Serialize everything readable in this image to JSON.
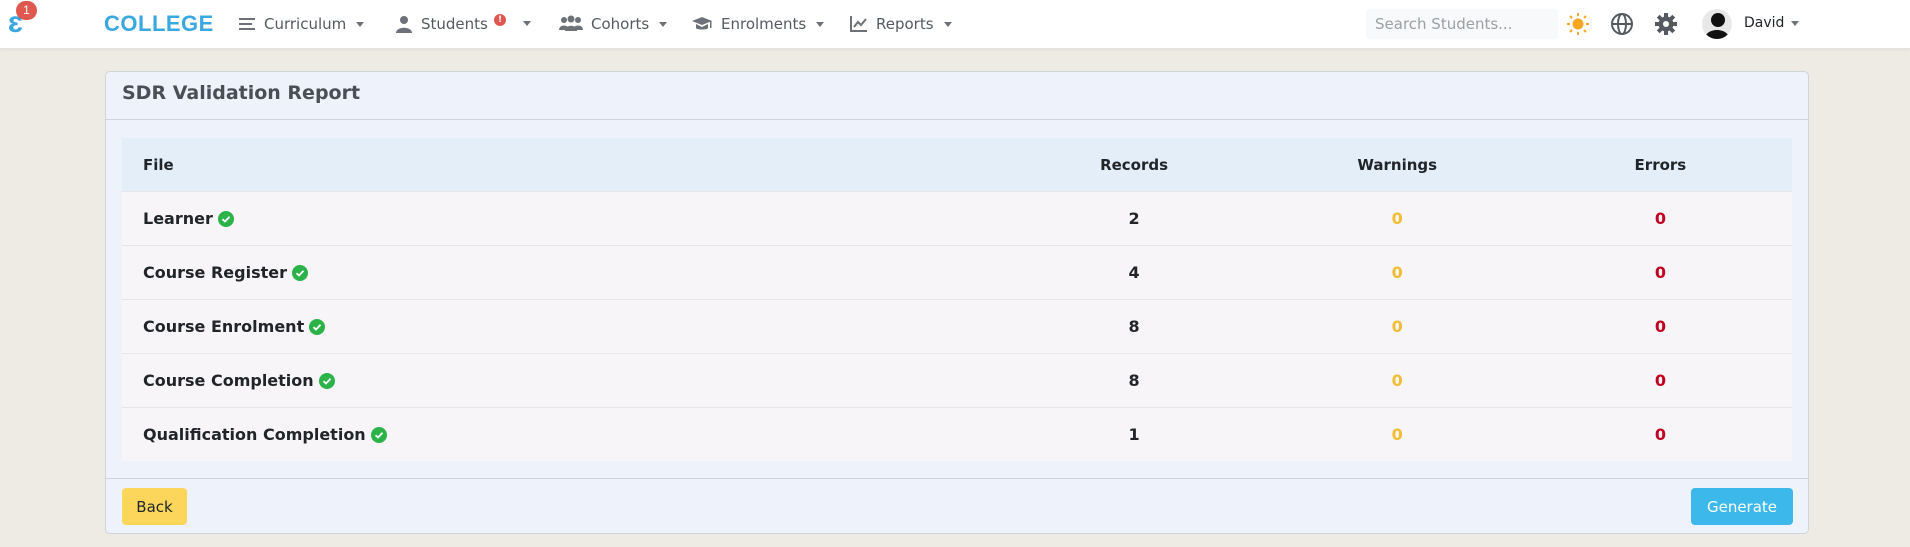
{
  "navbar": {
    "logo_badge": "1",
    "brand": "COLLEGE",
    "items": [
      {
        "label": "Curriculum",
        "icon": "menu-icon"
      },
      {
        "label": "Students",
        "icon": "user-icon",
        "alert": "!"
      },
      {
        "label": "Cohorts",
        "icon": "users-icon"
      },
      {
        "label": "Enrolments",
        "icon": "graduation-cap-icon"
      },
      {
        "label": "Reports",
        "icon": "chart-line-icon"
      }
    ],
    "search_placeholder": "Search Students...",
    "user": "David"
  },
  "report": {
    "title": "SDR Validation Report",
    "columns": [
      "File",
      "Records",
      "Warnings",
      "Errors"
    ],
    "rows": [
      {
        "file": "Learner",
        "records": "2",
        "warnings": "0",
        "errors": "0"
      },
      {
        "file": "Course Register",
        "records": "4",
        "warnings": "0",
        "errors": "0"
      },
      {
        "file": "Course Enrolment",
        "records": "8",
        "warnings": "0",
        "errors": "0"
      },
      {
        "file": "Course Completion",
        "records": "8",
        "warnings": "0",
        "errors": "0"
      },
      {
        "file": "Qualification Completion",
        "records": "1",
        "warnings": "0",
        "errors": "0"
      }
    ],
    "back_label": "Back",
    "generate_label": "Generate"
  },
  "colors": {
    "brand": "#3aa8e0",
    "warning": "#f0bd36",
    "error": "#c0001f",
    "valid": "#2bb34a",
    "back_button": "#fcd55b",
    "generate_button": "#3cb9ea"
  }
}
